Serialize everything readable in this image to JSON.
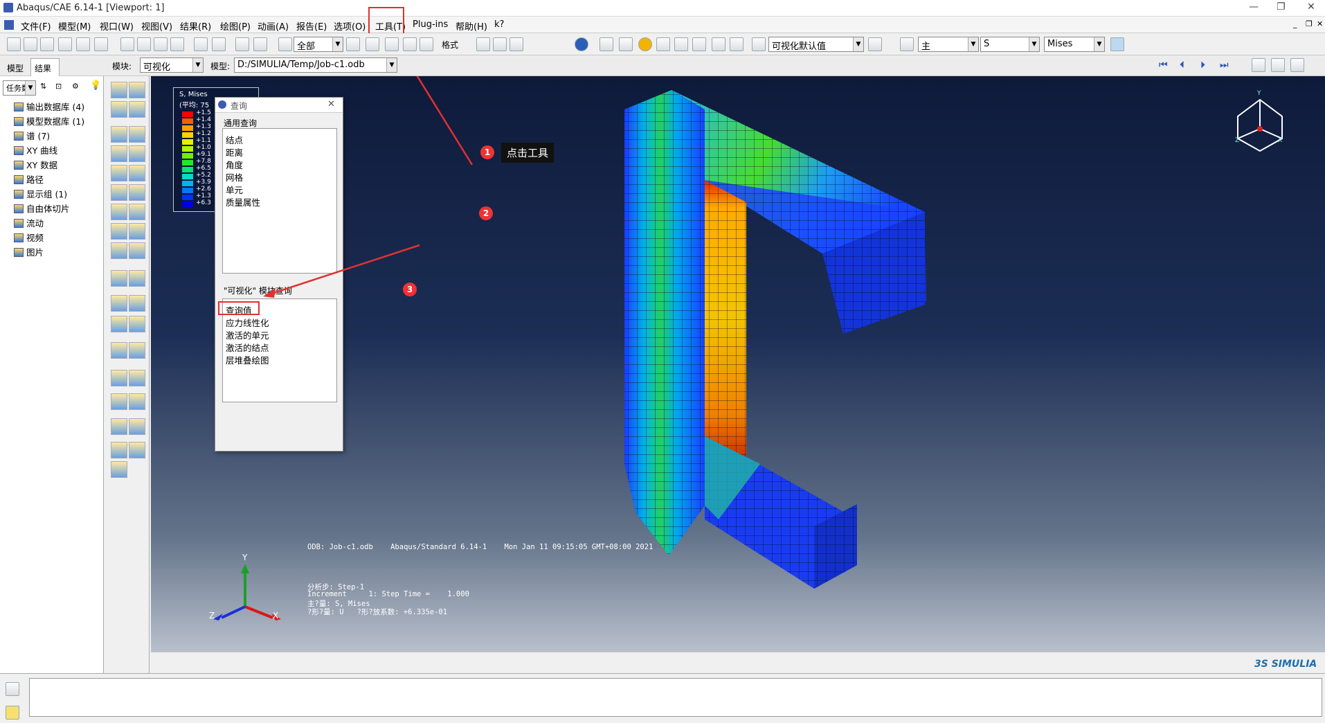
{
  "window": {
    "title": "Abaqus/CAE 6.14-1 [Viewport: 1]"
  },
  "menu": [
    "文件(F)",
    "模型(M)",
    "视口(W)",
    "视图(V)",
    "结果(R)",
    "绘图(P)",
    "动画(A)",
    "报告(E)",
    "选项(O)",
    "工具(T)",
    "Plug-ins",
    "帮助(H)",
    "k?"
  ],
  "toolbar": {
    "select_value": "全部",
    "format_label": "格式",
    "view_defaults": "可视化默认值",
    "variable_primary": "主",
    "variable_name": "S",
    "variable_component": "Mises"
  },
  "context": {
    "module_label": "模块:",
    "module_value": "可视化",
    "model_label": "模型:",
    "model_value": "D:/SIMULIA/Temp/Job-c1.odb"
  },
  "tabs": [
    "模型",
    "结果"
  ],
  "tree_toolbar": {
    "task_label": "任务数"
  },
  "tree": [
    "输出数据库 (4)",
    "模型数据库 (1)",
    "谱 (7)",
    "XY 曲线",
    "XY 数据",
    "路径",
    "显示组 (1)",
    "自由体切片",
    "流动",
    "视频",
    "图片"
  ],
  "legend": {
    "title": "S, Mises",
    "subtitle": "(平均: 75",
    "values": [
      "+1.5",
      "+1.4",
      "+1.3",
      "+1.2",
      "+1.1",
      "+1.0",
      "+9.1",
      "+7.8",
      "+6.5",
      "+5.2",
      "+3.9",
      "+2.6",
      "+1.3",
      "+6.3"
    ],
    "colors": [
      "#ff0000",
      "#ff5a00",
      "#ffa000",
      "#ffd200",
      "#e6f000",
      "#b4f500",
      "#6ef000",
      "#28e628",
      "#00e678",
      "#00dcc8",
      "#00b4f0",
      "#0078ff",
      "#0032ff",
      "#0000e6"
    ]
  },
  "query_dialog": {
    "title": "查询",
    "general_title": "通用查询",
    "general_items": [
      "结点",
      "距离",
      "角度",
      "网格",
      "单元",
      "质量属性"
    ],
    "module_title": "\"可视化\" 模块查询",
    "module_items": [
      "查询值",
      "应力线性化",
      "激活的单元",
      "激活的结点",
      "层堆叠绘图"
    ]
  },
  "annotations": {
    "step1_badge": "1",
    "step1_label": "点击工具",
    "step2_badge": "2",
    "step3_badge": "3"
  },
  "viewport_info": {
    "odb_line": "ODB: Job-c1.odb    Abaqus/Standard 6.14-1    Mon Jan 11 09:15:05 GMT+08:00 2021",
    "step_line": "分析步: Step-1",
    "increment_line": "Increment     1: Step Time =    1.000",
    "primary_line": "主?量: S, Mises",
    "deform_line": "?形?量: U   ?形?放系数: +6.335e-01"
  },
  "triad": {
    "y": "Y",
    "z": "Z",
    "x": "X"
  },
  "mini_triad": {
    "y": "Y",
    "z": "Z",
    "x": "X"
  },
  "brand": "3S SIMULIA",
  "colors": {
    "highlight": "#e03030",
    "viewport_top": "#0e1a3a",
    "viewport_bottom": "#b9c0cc"
  }
}
